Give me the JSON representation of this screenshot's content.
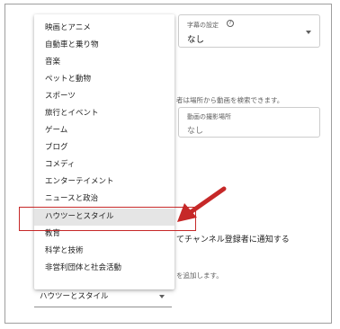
{
  "subtitle_setting": {
    "label": "字幕の設定",
    "help_icon": "question-circle-icon",
    "value": "なし"
  },
  "search_hint": {
    "text": "者は場所から動画を検索できます。"
  },
  "recording_location": {
    "label": "動画の撮影場所",
    "placeholder": "なし"
  },
  "notify": {
    "text": "てチャンネル登録者に通知する"
  },
  "add_note": {
    "text": "を追加します。"
  },
  "category_menu": {
    "items": [
      "映画とアニメ",
      "自動車と乗り物",
      "音楽",
      "ペットと動物",
      "スポーツ",
      "旅行とイベント",
      "ゲーム",
      "ブログ",
      "コメディ",
      "エンターテイメント",
      "ニュースと政治",
      "ハウツーとスタイル",
      "教育",
      "科学と技術",
      "非営利団体と社会活動"
    ],
    "selected_index": 11
  },
  "category_select": {
    "value": "ハウツーとスタイル",
    "icon": "dropdown-arrow-icon"
  },
  "annotation": {
    "arrow_color": "#c62828",
    "box_color": "#c62828"
  }
}
